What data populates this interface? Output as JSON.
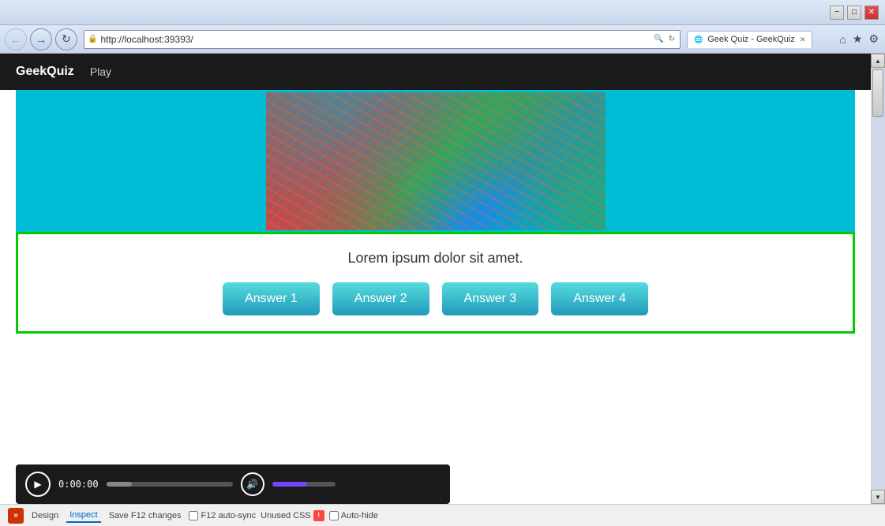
{
  "browser": {
    "title": "Geek Quiz - GeekQuiz",
    "address": "http://localhost:39393/",
    "back_btn": "←",
    "forward_btn": "→",
    "refresh_btn": "↻",
    "search_btn": "🔍",
    "home_btn": "⌂",
    "star_btn": "★",
    "settings_btn": "⚙",
    "minimize_btn": "−",
    "maximize_btn": "□",
    "close_btn": "✕"
  },
  "app": {
    "brand": "GeekQuiz",
    "nav_play": "Play"
  },
  "quiz": {
    "question": "Lorem ipsum dolor sit amet.",
    "answers": [
      "Answer 1",
      "Answer 2",
      "Answer 3",
      "Answer 4"
    ]
  },
  "media": {
    "time": "0:00:00",
    "play_icon": "▶"
  },
  "devtools": {
    "icon_label": "»",
    "design_btn": "Design",
    "inspect_btn": "Inspect",
    "save_btn": "Save F12 changes",
    "autosync_label": "F12 auto-sync",
    "unused_css_label": "Unused CSS",
    "autohide_label": "Auto-hide"
  },
  "scrollbar": {
    "up_arrow": "▲",
    "down_arrow": "▼"
  }
}
